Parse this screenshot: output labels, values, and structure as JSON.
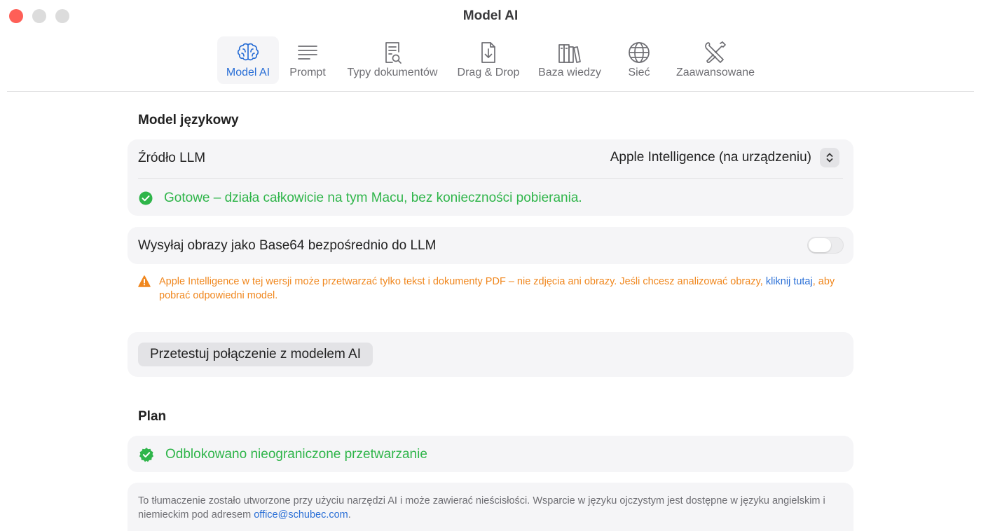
{
  "window": {
    "title": "Model AI"
  },
  "tabs": [
    {
      "label": "Model AI",
      "icon": "brain-icon",
      "active": true
    },
    {
      "label": "Prompt",
      "icon": "text-lines-icon"
    },
    {
      "label": "Typy dokumentów",
      "icon": "document-search-icon"
    },
    {
      "label": "Drag & Drop",
      "icon": "document-download-icon"
    },
    {
      "label": "Baza wiedzy",
      "icon": "books-icon"
    },
    {
      "label": "Sieć",
      "icon": "globe-icon"
    },
    {
      "label": "Zaawansowane",
      "icon": "tools-icon"
    }
  ],
  "language_model": {
    "section_title": "Model językowy",
    "llm_source_label": "Źródło LLM",
    "llm_source_value": "Apple Intelligence (na urządzeniu)",
    "status_text": "Gotowe – działa całkowicie na tym Macu, bez konieczności pobierania.",
    "base64_label": "Wysyłaj obrazy jako Base64 bezpośrednio do LLM",
    "base64_enabled": false,
    "warning_text_1": "Apple Intelligence w tej wersji może przetwarzać tylko tekst i dokumenty PDF – nie zdjęcia ani obrazy. Jeśli chcesz analizować obrazy,",
    "warning_link": "kliknij tutaj",
    "warning_text_2": ", aby pobrać odpowiedni model.",
    "test_button": "Przetestuj połączenie z modelem AI"
  },
  "plan": {
    "section_title": "Plan",
    "status_text": "Odblokowano nieograniczone przetwarzanie"
  },
  "footer": {
    "text": "To tłumaczenie zostało utworzone przy użyciu narzędzi AI i może zawierać nieścisłości. Wsparcie w języku ojczystym jest dostępne w języku angielskim i niemieckim pod adresem",
    "email": "office@schubec.com",
    "end": "."
  },
  "colors": {
    "accent": "#2a6fd6",
    "success": "#2fb54a",
    "warning": "#f0871e",
    "card": "#f5f5f7"
  }
}
